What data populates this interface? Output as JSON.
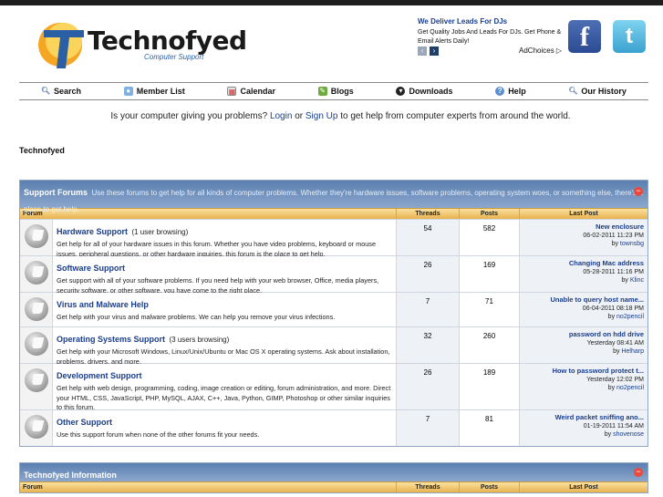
{
  "header": {
    "logo_text": "Technofyed",
    "logo_sub": "Computer Support",
    "ad_title": "We Deliver Leads For DJs",
    "ad_body": "Get Quality Jobs And Leads For DJs. Get Phone & Email Alerts Daily!",
    "adchoices": "AdChoices",
    "facebook_glyph": "f",
    "twitter_glyph": "t"
  },
  "nav": {
    "items": [
      {
        "label": "Search",
        "icon": "magnifier-icon"
      },
      {
        "label": "Member List",
        "icon": "members-icon"
      },
      {
        "label": "Calendar",
        "icon": "calendar-icon"
      },
      {
        "label": "Blogs",
        "icon": "blogs-icon"
      },
      {
        "label": "Downloads",
        "icon": "downloads-icon"
      },
      {
        "label": "Help",
        "icon": "help-icon"
      },
      {
        "label": "Our History",
        "icon": "history-icon"
      }
    ]
  },
  "prompt": {
    "before": "Is your computer giving you problems?",
    "login": "Login",
    "or": "or",
    "signup": "Sign Up",
    "after": "to get help from computer experts from around the world."
  },
  "breadcrumb": "Technofyed",
  "support": {
    "title": "Support Forums",
    "desc": "Use these forums to get help for all kinds of computer problems. Whether they're hardware issues, software problems, operating system woes, or something else, there's a place to get help.",
    "collapse": "−",
    "columns": {
      "forum": "Forum",
      "threads": "Threads",
      "posts": "Posts",
      "last": "Last Post"
    },
    "rows": [
      {
        "title": "Hardware Support",
        "browsing": "(1 user browsing)",
        "desc": "Get help for all of your hardware issues in this forum. Whether you have video problems, keyboard or mouse issues, peripheral questions, or other hardware inquiries, this forum is the place to get help.",
        "threads": "54",
        "posts": "582",
        "last_title": "New enclosure",
        "last_date": "06-02-2011 11:23 PM",
        "last_by": "by",
        "last_user": "townsbg"
      },
      {
        "title": "Software Support",
        "browsing": "",
        "desc": "Get support with all of your software problems. If you need help with your web browser, Office, media players, security software, or other software, you have come to the right place.",
        "threads": "26",
        "posts": "169",
        "last_title": "Changing Mac address",
        "last_date": "05-28-2011 11:16 PM",
        "last_by": "by",
        "last_user": "Klinc"
      },
      {
        "title": "Virus and Malware Help",
        "browsing": "",
        "desc": "Get help with your virus and malware problems. We can help you remove your virus infections.",
        "threads": "7",
        "posts": "71",
        "last_title": "Unable to query host name...",
        "last_date": "06-04-2011 08:18 PM",
        "last_by": "by",
        "last_user": "no2pencil"
      },
      {
        "title": "Operating Systems Support",
        "browsing": "(3 users browsing)",
        "desc": "Get help with your Microsoft Windows, Linux/Unix/Ubuntu or Mac OS X operating systems. Ask about installation, problems, drivers, and more.",
        "threads": "32",
        "posts": "260",
        "last_title": "password on hdd drive",
        "last_date": "Yesterday 08:41 AM",
        "last_by": "by",
        "last_user": "Helharp"
      },
      {
        "title": "Development Support",
        "browsing": "",
        "desc": "Get help with web design, programming, coding, image creation or editing, forum administration, and more. Direct your HTML, CSS, JavaScript, PHP, MySQL, AJAX, C++, Java, Python, GIMP, Photoshop or other similar inquiries to this forum.",
        "threads": "26",
        "posts": "189",
        "last_title": "How to password protect t...",
        "last_date": "Yesterday 12:02 PM",
        "last_by": "by",
        "last_user": "no2pencil"
      },
      {
        "title": "Other Support",
        "browsing": "",
        "desc": "Use this support forum when none of the other forums fit your needs.",
        "threads": "7",
        "posts": "81",
        "last_title": "Weird packet sniffing ano...",
        "last_date": "01-19-2011 11:54 AM",
        "last_by": "by",
        "last_user": "shovenose"
      }
    ]
  },
  "info": {
    "title": "Technofyed Information",
    "collapse": "−",
    "columns": {
      "forum": "Forum",
      "threads": "Threads",
      "posts": "Posts",
      "last": "Last Post"
    }
  },
  "colors": {
    "accent": "#1a3e8c",
    "header_blue": "#5a7fb0",
    "column_gold": "#e8b24d"
  }
}
